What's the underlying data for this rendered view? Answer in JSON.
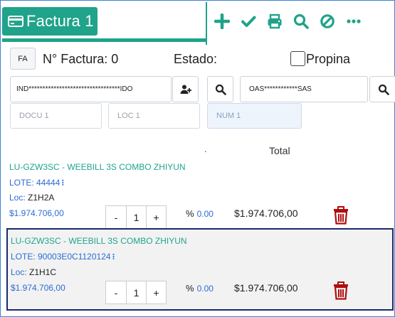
{
  "header": {
    "title": "Factura 1",
    "toolbar": [
      "add-icon",
      "check-icon",
      "print-icon",
      "search-icon",
      "ban-icon",
      "more-icon"
    ],
    "accent": "#1fa38a"
  },
  "invoice": {
    "type_button": "FA",
    "number_label": "N° Factura: 0",
    "estado_label": "Estado:",
    "propina_label": "Propina",
    "propina_checked": false
  },
  "client": {
    "value": "IND*********************************IDO"
  },
  "vendor": {
    "value": "OAS************SAS"
  },
  "fields": {
    "docu_placeholder": "DOCU 1",
    "loc_placeholder": "LOC 1",
    "num_placeholder": "NUM 1"
  },
  "table": {
    "dot": ".",
    "total_header": "Total"
  },
  "products": [
    {
      "name": "LU-GZW3SC - WEEBILL 3S COMBO ZHIYUN",
      "lote_label": "LOTE: 44444",
      "loc_key": "Loc:",
      "loc_value": "Z1H2A",
      "price": "$1.974.706,00",
      "minus": "-",
      "qty": "1",
      "plus": "+",
      "pct_label": "%",
      "pct_value": "0.00",
      "total": "$1.974.706,00",
      "selected": false
    },
    {
      "name": "LU-GZW3SC - WEEBILL 3S COMBO ZHIYUN",
      "lote_label": "LOTE: 90003E0C1120124",
      "loc_key": "Loc:",
      "loc_value": "Z1H1C",
      "price": "$1.974.706,00",
      "minus": "-",
      "qty": "1",
      "plus": "+",
      "pct_label": "%",
      "pct_value": "0.00",
      "total": "$1.974.706,00",
      "selected": true
    }
  ]
}
